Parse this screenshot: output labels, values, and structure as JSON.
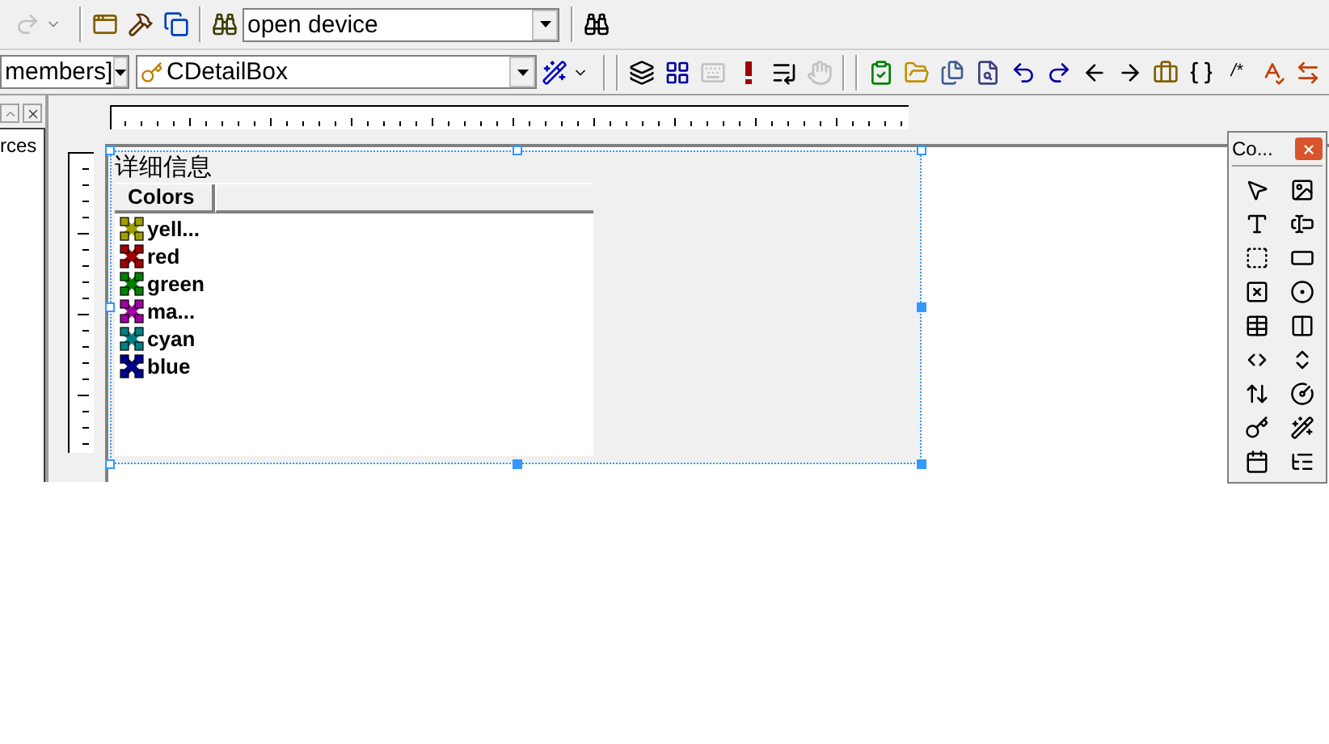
{
  "toolbar": {
    "find_combo": {
      "value": "open device"
    }
  },
  "wizard_bar": {
    "members_combo": {
      "value": "members]"
    },
    "class_combo": {
      "value": "CDetailBox"
    },
    "comment_button": {
      "label": "/*"
    }
  },
  "workspace": {
    "text": "rces"
  },
  "dialog": {
    "title": "详细信息",
    "list": {
      "columns": [
        "Colors"
      ],
      "items": [
        {
          "label": "yell...",
          "color": "#a0a000"
        },
        {
          "label": "red",
          "color": "#a00000"
        },
        {
          "label": "green",
          "color": "#008000"
        },
        {
          "label": "ma...",
          "color": "#a000a0"
        },
        {
          "label": "cyan",
          "color": "#008080"
        },
        {
          "label": "blue",
          "color": "#000090"
        }
      ]
    }
  },
  "controls_palette": {
    "title": "Co..."
  }
}
